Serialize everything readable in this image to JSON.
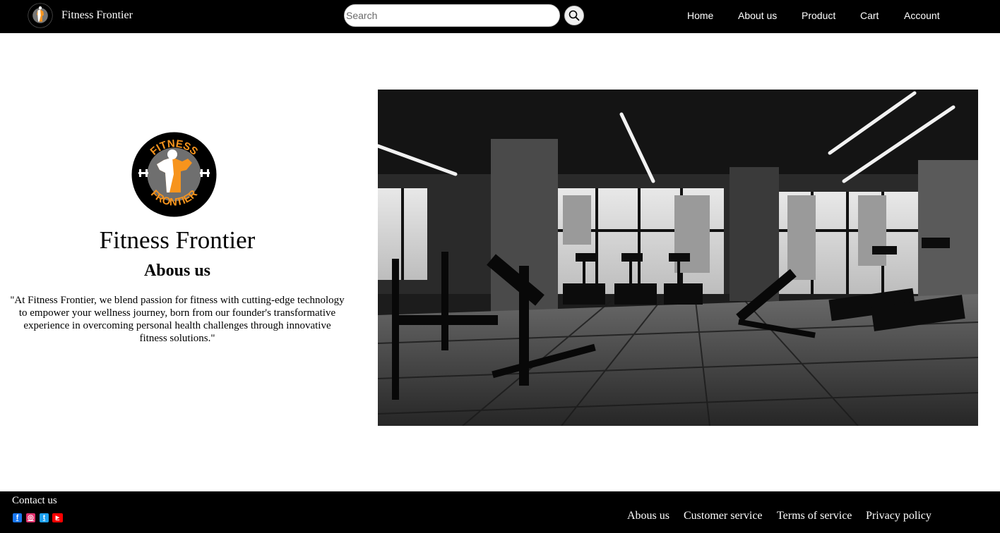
{
  "header": {
    "brand_name": "Fitness Frontier",
    "search": {
      "placeholder": "Search",
      "value": ""
    },
    "nav": [
      "Home",
      "About us",
      "Product",
      "Cart",
      "Account"
    ]
  },
  "logo": {
    "top_text": "FITNESS",
    "bottom_text": "FRONTIER",
    "accent_color": "#f7941d"
  },
  "main": {
    "title": "Fitness Frontier",
    "subtitle": "Abous us",
    "description": "\"At Fitness Frontier, we blend passion for fitness with cutting-edge technology to empower your wellness journey, born from our founder's transformative experience in overcoming personal health challenges through innovative fitness solutions.\""
  },
  "footer": {
    "contact_title": "Contact us",
    "socials": [
      {
        "icon": "facebook-icon",
        "glyph": "f",
        "color": "#1877f2"
      },
      {
        "icon": "instagram-icon",
        "glyph": "◎",
        "color": "#e1306c"
      },
      {
        "icon": "twitter-icon",
        "glyph": "t",
        "color": "#1da1f2"
      },
      {
        "icon": "youtube-icon",
        "glyph": "▶",
        "color": "#ff0000"
      }
    ],
    "links": [
      "Abous us",
      "Customer service",
      "Terms of service",
      "Privacy policy"
    ]
  }
}
